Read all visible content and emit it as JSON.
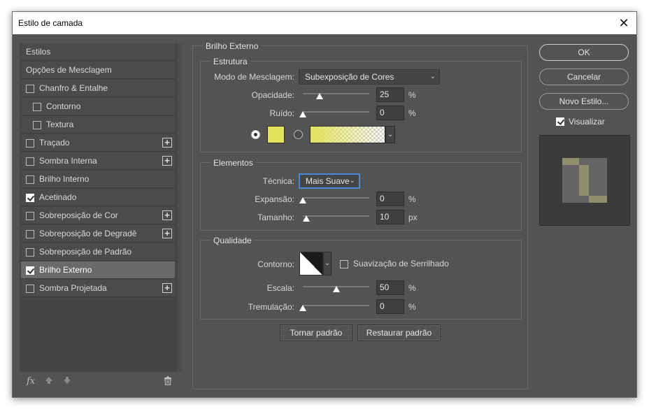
{
  "window": {
    "title": "Estilo de camada",
    "close_glyph": "✕"
  },
  "left_panel": {
    "header_styles": "Estilos",
    "header_blend": "Opções de Mesclagem",
    "items": [
      {
        "label": "Chanfro & Entalhe",
        "checked": false,
        "has_plus": false,
        "indent": false
      },
      {
        "label": "Contorno",
        "checked": false,
        "has_plus": false,
        "indent": true
      },
      {
        "label": "Textura",
        "checked": false,
        "has_plus": false,
        "indent": true
      },
      {
        "label": "Traçado",
        "checked": false,
        "has_plus": true,
        "indent": false
      },
      {
        "label": "Sombra Interna",
        "checked": false,
        "has_plus": true,
        "indent": false
      },
      {
        "label": "Brilho Interno",
        "checked": false,
        "has_plus": false,
        "indent": false
      },
      {
        "label": "Acetinado",
        "checked": true,
        "has_plus": false,
        "indent": false
      },
      {
        "label": "Sobreposição de Cor",
        "checked": false,
        "has_plus": true,
        "indent": false
      },
      {
        "label": "Sobreposição de Degradê",
        "checked": false,
        "has_plus": true,
        "indent": false
      },
      {
        "label": "Sobreposição de Padrão",
        "checked": false,
        "has_plus": false,
        "indent": false
      },
      {
        "label": "Brilho Externo",
        "checked": true,
        "has_plus": false,
        "indent": false,
        "selected": true
      },
      {
        "label": "Sombra Projetada",
        "checked": false,
        "has_plus": true,
        "indent": false
      }
    ],
    "plus_glyph": "+",
    "fx_label": "fx",
    "icon_names": [
      "fx-icon",
      "move-up-icon",
      "move-down-icon",
      "trash-icon"
    ]
  },
  "center": {
    "section_title": "Brilho Externo",
    "structure": {
      "title": "Estrutura",
      "blend_mode_label": "Modo de Mesclagem:",
      "blend_mode_value": "Subexposição de Cores",
      "opacity_label": "Opacidade:",
      "opacity_value": "25",
      "opacity_fraction": 0.25,
      "opacity_unit": "%",
      "noise_label": "Ruído:",
      "noise_value": "0",
      "noise_fraction": 0,
      "noise_unit": "%",
      "glow_color": "#e2e25c"
    },
    "elements": {
      "title": "Elementos",
      "technique_label": "Técnica:",
      "technique_value": "Mais Suave",
      "spread_label": "Expansão:",
      "spread_value": "0",
      "spread_fraction": 0,
      "spread_unit": "%",
      "size_label": "Tamanho:",
      "size_value": "10",
      "size_fraction": 0.05,
      "size_unit": "px"
    },
    "quality": {
      "title": "Qualidade",
      "contour_label": "Contorno:",
      "antialias_label": "Suavização de Serrilhado",
      "antialias_checked": false,
      "range_label": "Escala:",
      "range_value": "50",
      "range_fraction": 0.5,
      "range_unit": "%",
      "jitter_label": "Tremulação:",
      "jitter_value": "0",
      "jitter_fraction": 0,
      "jitter_unit": "%"
    },
    "make_default_label": "Tornar padrão",
    "reset_default_label": "Restaurar padrão"
  },
  "right_panel": {
    "ok_label": "OK",
    "cancel_label": "Cancelar",
    "new_style_label": "Novo Estilo...",
    "preview_label": "Visualizar",
    "preview_checked": true
  }
}
